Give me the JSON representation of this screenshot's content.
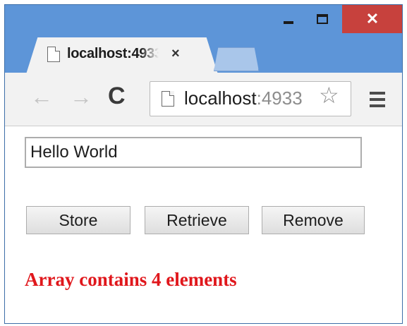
{
  "window": {
    "close_glyph": "✕"
  },
  "tab": {
    "title": "localhost:4933",
    "close_glyph": "×"
  },
  "toolbar": {
    "back_glyph": "←",
    "forward_glyph": "→",
    "reload_glyph": "C",
    "url_host": "localhost",
    "url_port": ":4933",
    "star_glyph": "☆"
  },
  "page": {
    "input_value": "Hello World",
    "store_label": "Store",
    "retrieve_label": "Retrieve",
    "remove_label": "Remove",
    "status_text": "Array contains 4 elements"
  },
  "colors": {
    "titlebar": "#5d95d8",
    "close_button": "#c7413d",
    "status_text": "#e0171c"
  },
  "icons": [
    "file-icon",
    "back-icon",
    "forward-icon",
    "reload-icon",
    "star-icon",
    "menu-icon",
    "minimize-icon",
    "maximize-icon",
    "close-icon"
  ]
}
